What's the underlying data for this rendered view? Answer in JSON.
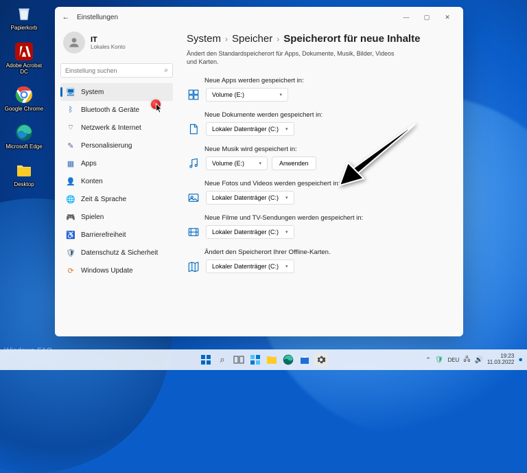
{
  "desktop": {
    "icons": [
      {
        "label": "Papierkorb"
      },
      {
        "label": "Adobe Acrobat DC"
      },
      {
        "label": "Google Chrome"
      },
      {
        "label": "Microsoft Edge"
      },
      {
        "label": "Desktop"
      }
    ],
    "watermark": "Windows-FAQ"
  },
  "window": {
    "title": "Einstellungen",
    "account": {
      "name": "IT",
      "type": "Lokales Konto"
    },
    "search_placeholder": "Einstellung suchen",
    "nav": [
      {
        "label": "System",
        "active": true
      },
      {
        "label": "Bluetooth & Geräte"
      },
      {
        "label": "Netzwerk & Internet"
      },
      {
        "label": "Personalisierung"
      },
      {
        "label": "Apps"
      },
      {
        "label": "Konten"
      },
      {
        "label": "Zeit & Sprache"
      },
      {
        "label": "Spielen"
      },
      {
        "label": "Barrierefreiheit"
      },
      {
        "label": "Datenschutz & Sicherheit"
      },
      {
        "label": "Windows Update"
      }
    ],
    "breadcrumb": [
      "System",
      "Speicher",
      "Speicherort für neue Inhalte"
    ],
    "subtitle": "Ändert den Standardspeicherort für Apps, Dokumente, Musik, Bilder, Videos und Karten.",
    "settings": [
      {
        "label": "Neue Apps werden gespeichert in:",
        "value": "Volume (E:)",
        "apply": false
      },
      {
        "label": "Neue Dokumente werden gespeichert in:",
        "value": "Lokaler Datenträger (C:)",
        "apply": false
      },
      {
        "label": "Neue Musik wird gespeichert in:",
        "value": "Volume (E:)",
        "apply": true,
        "apply_label": "Anwenden"
      },
      {
        "label": "Neue Fotos und Videos werden gespeichert in:",
        "value": "Lokaler Datenträger (C:)",
        "apply": false
      },
      {
        "label": "Neue Filme und TV-Sendungen werden gespeichert in:",
        "value": "Lokaler Datenträger (C:)",
        "apply": false
      },
      {
        "label": "Ändert den Speicherort Ihrer Offline-Karten.",
        "value": "Lokaler Datenträger (C:)",
        "apply": false
      }
    ]
  },
  "taskbar": {
    "lang": "DEU",
    "time": "19:23",
    "date": "11.03.2022"
  }
}
